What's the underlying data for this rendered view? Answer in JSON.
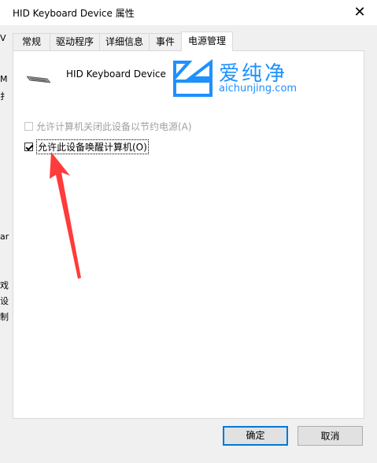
{
  "window": {
    "title": "HID Keyboard Device 属性",
    "close_glyph": "✕"
  },
  "tabs": [
    {
      "label": "常规"
    },
    {
      "label": "驱动程序"
    },
    {
      "label": "详细信息"
    },
    {
      "label": "事件"
    },
    {
      "label": "电源管理"
    }
  ],
  "active_tab": "电源管理",
  "device": {
    "name": "HID Keyboard Device",
    "icon": "keyboard-icon"
  },
  "options": {
    "allow_power_off": {
      "label": "允许计算机关闭此设备以节约电源(A)",
      "checked": false,
      "enabled": false
    },
    "allow_wake": {
      "label": "允许此设备唤醒计算机(O)",
      "checked": true,
      "enabled": true
    }
  },
  "watermark": {
    "cn": "爱纯净",
    "en": "aichunjing.com",
    "color": "#1e90ff"
  },
  "annotation": {
    "arrow_color": "#ff3b3b"
  },
  "buttons": {
    "ok": "确定",
    "cancel": "取消"
  },
  "left_edge_glyphs": [
    "V",
    "M",
    "扌",
    "ar",
    "戏",
    "设",
    "制"
  ]
}
